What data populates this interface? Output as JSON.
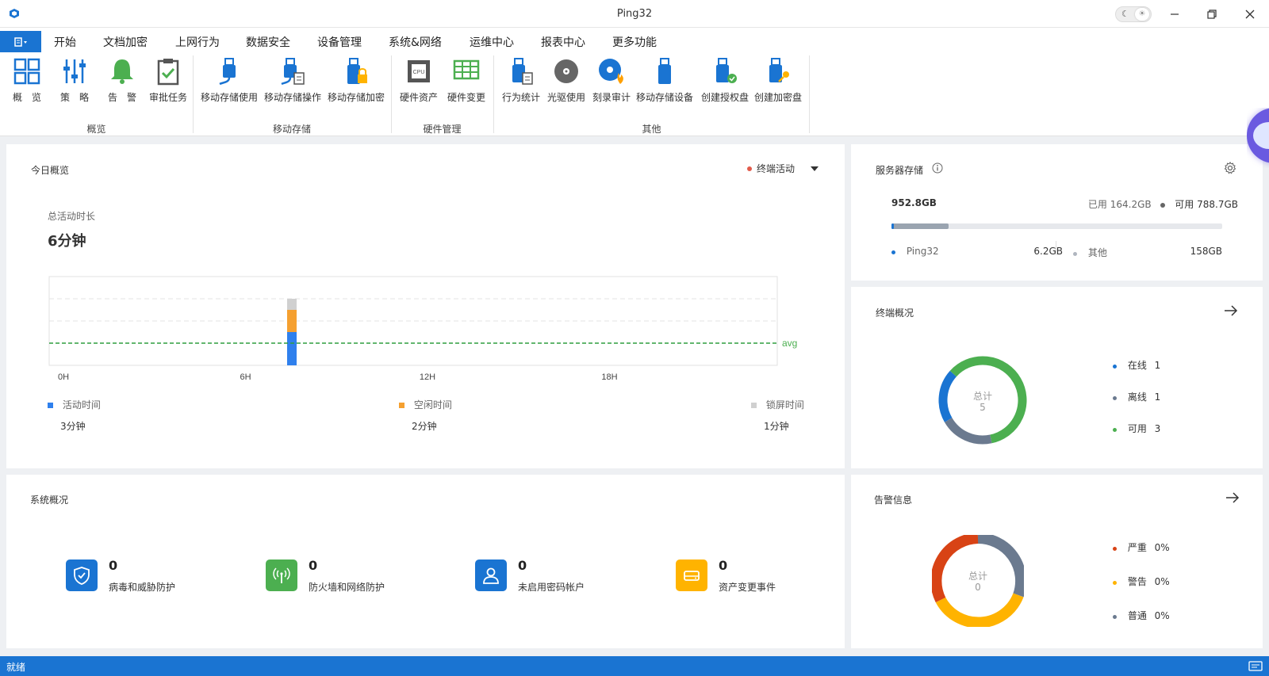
{
  "window": {
    "title": "Ping32"
  },
  "colors": {
    "accent": "#1a74d2",
    "green": "#4caf50",
    "orange": "#f5a030",
    "gray": "#d0d0d0",
    "online": "#1a74d2",
    "offline": "#6b7a8f",
    "available": "#4caf50",
    "severe": "#d84315",
    "warning": "#ffb300",
    "normal": "#6b7a8f"
  },
  "menu": {
    "tabs": [
      "开始",
      "文档加密",
      "上网行为",
      "数据安全",
      "设备管理",
      "系统&网络",
      "运维中心",
      "报表中心",
      "更多功能"
    ],
    "active": "设备管理"
  },
  "ribbon": {
    "items": [
      {
        "label": "概　览",
        "icon": "grid-icon"
      },
      {
        "label": "策　略",
        "icon": "sliders-icon"
      },
      {
        "label": "告　警",
        "icon": "bell-icon"
      },
      {
        "label": "审批任务",
        "icon": "clipboard-check-icon"
      },
      {
        "label": "移动存储使用",
        "icon": "usb-icon"
      },
      {
        "label": "移动存储操作",
        "icon": "usb-doc-icon"
      },
      {
        "label": "移动存储加密",
        "icon": "usb-lock-icon"
      },
      {
        "label": "硬件资产",
        "icon": "cpu-icon"
      },
      {
        "label": "硬件变更",
        "icon": "hardware-table-icon"
      },
      {
        "label": "行为统计",
        "icon": "usb-stats-icon"
      },
      {
        "label": "光驱使用",
        "icon": "disc-icon"
      },
      {
        "label": "刻录审计",
        "icon": "disc-burn-icon"
      },
      {
        "label": "移动存储设备",
        "icon": "usb-device-icon"
      },
      {
        "label": "创建授权盘",
        "icon": "usb-auth-icon"
      },
      {
        "label": "创建加密盘",
        "icon": "usb-key-icon"
      }
    ],
    "groups": [
      "概览",
      "移动存储",
      "硬件管理",
      "其他"
    ]
  },
  "today": {
    "title": "今日概览",
    "filter": "终端活动",
    "total_label": "总活动时长",
    "total_value": "6分钟",
    "avg_label": "avg",
    "legend": [
      {
        "name": "活动时间",
        "value": "3分钟"
      },
      {
        "name": "空闲时间",
        "value": "2分钟"
      },
      {
        "name": "锁屏时间",
        "value": "1分钟"
      }
    ]
  },
  "chart_data": {
    "type": "bar",
    "x_ticks": [
      "0H",
      "6H",
      "12H",
      "18H"
    ],
    "xlim": [
      0,
      24
    ],
    "bar_hour": 8,
    "series": [
      {
        "name": "活动时间",
        "values": [
          3
        ]
      },
      {
        "name": "空闲时间",
        "values": [
          2
        ]
      },
      {
        "name": "锁屏时间",
        "values": [
          1
        ]
      }
    ],
    "avg": 2,
    "ylim": [
      0,
      8
    ],
    "grid": true
  },
  "storage": {
    "title": "服务器存储",
    "total": "952.8GB",
    "used_label": "已用",
    "used": "164.2GB",
    "free_label": "可用",
    "free": "788.7GB",
    "used_fraction": 0.172,
    "ping_fraction": 0.007,
    "items": [
      {
        "name": "Ping32",
        "value": "6.2GB"
      },
      {
        "name": "其他",
        "value": "158GB"
      }
    ]
  },
  "terminal": {
    "title": "终端概况",
    "center_label": "总计",
    "center_value": "5",
    "items": [
      {
        "name": "在线",
        "value": "1",
        "count": 1
      },
      {
        "name": "离线",
        "value": "1",
        "count": 1
      },
      {
        "name": "可用",
        "value": "3",
        "count": 3
      }
    ]
  },
  "system": {
    "title": "系统概况",
    "cards": [
      {
        "value": "0",
        "label": "病毒和威胁防护",
        "icon": "shield-icon"
      },
      {
        "value": "0",
        "label": "防火墙和网络防护",
        "icon": "antenna-icon"
      },
      {
        "value": "0",
        "label": "未启用密码帐户",
        "icon": "user-icon"
      },
      {
        "value": "0",
        "label": "资产变更事件",
        "icon": "drive-icon"
      }
    ]
  },
  "alerts": {
    "title": "告警信息",
    "center_label": "总计",
    "center_value": "0",
    "items": [
      {
        "name": "严重",
        "value": "0%"
      },
      {
        "name": "警告",
        "value": "0%"
      },
      {
        "name": "普通",
        "value": "0%"
      }
    ]
  },
  "status_bar": {
    "text": "就绪"
  }
}
